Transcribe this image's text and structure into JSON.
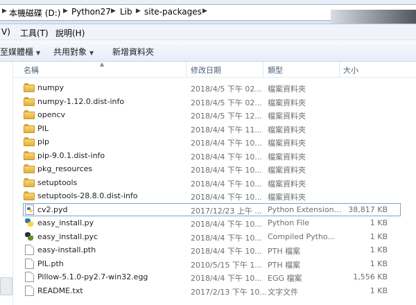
{
  "address": {
    "crumbs": [
      "本機磁碟 (D:)",
      "Python27",
      "Lib",
      "site-packages"
    ]
  },
  "menu": {
    "view_fragment": "V)",
    "tools": "工具(T)",
    "help": "說明(H)"
  },
  "toolbar": {
    "library_fragment": "至媒體櫃",
    "share": "共用對象",
    "new_folder": "新增資料夾"
  },
  "columns": {
    "name": "名稱",
    "modified": "修改日期",
    "type": "類型",
    "size": "大小"
  },
  "files": [
    {
      "name": "numpy",
      "date": "2018/4/5 下午 02...",
      "type": "檔案資料夾",
      "size": "",
      "icon": "folder-icon"
    },
    {
      "name": "numpy-1.12.0.dist-info",
      "date": "2018/4/5 下午 02...",
      "type": "檔案資料夾",
      "size": "",
      "icon": "folder-icon"
    },
    {
      "name": "opencv",
      "date": "2018/4/5 下午 12...",
      "type": "檔案資料夾",
      "size": "",
      "icon": "folder-icon"
    },
    {
      "name": "PIL",
      "date": "2018/4/4 下午 11...",
      "type": "檔案資料夾",
      "size": "",
      "icon": "folder-icon"
    },
    {
      "name": "pip",
      "date": "2018/4/4 下午 10...",
      "type": "檔案資料夾",
      "size": "",
      "icon": "folder-icon"
    },
    {
      "name": "pip-9.0.1.dist-info",
      "date": "2018/4/4 下午 10...",
      "type": "檔案資料夾",
      "size": "",
      "icon": "folder-icon"
    },
    {
      "name": "pkg_resources",
      "date": "2018/4/4 下午 10...",
      "type": "檔案資料夾",
      "size": "",
      "icon": "folder-icon"
    },
    {
      "name": "setuptools",
      "date": "2018/4/4 下午 10...",
      "type": "檔案資料夾",
      "size": "",
      "icon": "folder-icon"
    },
    {
      "name": "setuptools-28.8.0.dist-info",
      "date": "2018/4/4 下午 10...",
      "type": "檔案資料夾",
      "size": "",
      "icon": "folder-icon"
    },
    {
      "name": "cv2.pyd",
      "date": "2017/12/23 上午 ...",
      "type": "Python Extension...",
      "size": "38,817 KB",
      "icon": "python-extension-icon",
      "selected": true
    },
    {
      "name": "easy_install.py",
      "date": "2018/4/4 下午 10...",
      "type": "Python File",
      "size": "1 KB",
      "icon": "python-file-icon"
    },
    {
      "name": "easy_install.pyc",
      "date": "2018/4/4 下午 10...",
      "type": "Compiled Pytho...",
      "size": "1 KB",
      "icon": "compiled-python-icon"
    },
    {
      "name": "easy-install.pth",
      "date": "2018/4/4 下午 10...",
      "type": "PTH 檔案",
      "size": "1 KB",
      "icon": "file-icon"
    },
    {
      "name": "PIL.pth",
      "date": "2010/5/15 下午 1...",
      "type": "PTH 檔案",
      "size": "1 KB",
      "icon": "file-icon"
    },
    {
      "name": "Pillow-5.1.0-py2.7-win32.egg",
      "date": "2018/4/4 下午 10...",
      "type": "EGG 檔案",
      "size": "1,556 KB",
      "icon": "file-icon"
    },
    {
      "name": "README.txt",
      "date": "2017/2/13 下午 10...",
      "type": "文字文件",
      "size": "1 KB",
      "icon": "text-file-icon"
    }
  ]
}
